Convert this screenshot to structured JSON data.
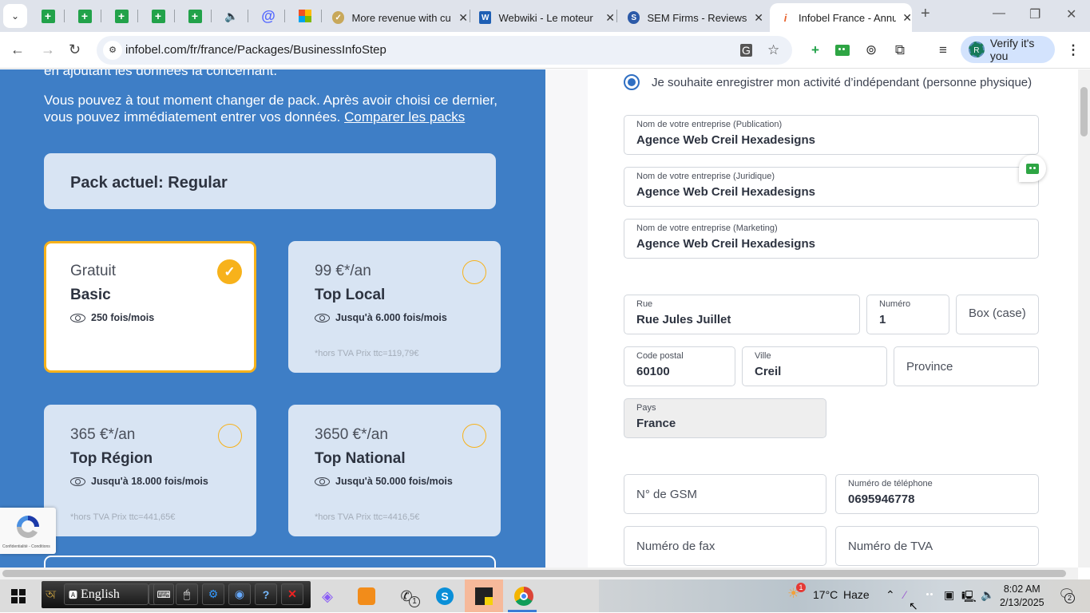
{
  "browser": {
    "pinned_tabs": [
      {
        "icon": "google-sheets-icon"
      },
      {
        "icon": "google-sheets-icon"
      },
      {
        "icon": "google-sheets-icon"
      },
      {
        "icon": "google-sheets-icon"
      },
      {
        "icon": "google-sheets-icon"
      },
      {
        "icon": "speaker-icon"
      },
      {
        "icon": "at-sign-icon"
      },
      {
        "icon": "microsoft-icon"
      }
    ],
    "tabs": [
      {
        "title": "More revenue with cu",
        "icon": "check-badge-icon",
        "active": false
      },
      {
        "title": "Webwiki - Le moteur",
        "icon": "webwiki-icon",
        "active": false
      },
      {
        "title": "SEM Firms - Reviews",
        "icon": "semfirms-icon",
        "active": false
      },
      {
        "title": "Infobel France - Annu",
        "icon": "infobel-icon",
        "active": true
      }
    ],
    "new_tab": "+",
    "window_controls": {
      "minimize": "—",
      "maximize": "❐",
      "close": "✕"
    },
    "url": "infobel.com/fr/france/Packages/BusinessInfoStep",
    "profile_button": "Verify it's you",
    "profile_initial": "R"
  },
  "left_panel": {
    "intro_cut": "en ajoutant les données la concernant.",
    "intro": "Vous pouvez à tout moment changer de pack. Après avoir choisi ce dernier, vous pouvez immédiatement entrer vos données.",
    "compare_link": "Comparer les packs",
    "current_pack": "Pack actuel: Regular",
    "packs": [
      {
        "price": "Gratuit",
        "name": "Basic",
        "views": "250 fois/mois",
        "tva": "",
        "selected": true
      },
      {
        "price": "99 €*/an",
        "name": "Top Local",
        "views": "Jusqu'à 6.000 fois/mois",
        "tva": "*hors TVA Prix ttc=119,79€",
        "selected": false
      },
      {
        "price": "365 €*/an",
        "name": "Top Région",
        "views": "Jusqu'à 18.000 fois/mois",
        "tva": "*hors TVA Prix ttc=441,65€",
        "selected": false
      },
      {
        "price": "3650 €*/an",
        "name": "Top National",
        "views": "Jusqu'à 50.000 fois/mois",
        "tva": "*hors TVA Prix ttc=4416,5€",
        "selected": false
      }
    ],
    "recaptcha_terms": "Confidentialité - Conditions"
  },
  "form": {
    "independent_option": "Je souhaite enregistrer mon activité d’indépendant (personne physique)",
    "company_publication": {
      "label": "Nom de votre entreprise (Publication)",
      "value": "Agence Web Creil Hexadesigns"
    },
    "company_legal": {
      "label": "Nom de votre entreprise (Juridique)",
      "value": "Agence Web Creil Hexadesigns"
    },
    "company_marketing": {
      "label": "Nom de votre entreprise (Marketing)",
      "value": "Agence Web Creil Hexadesigns"
    },
    "street": {
      "label": "Rue",
      "value": "Rue Jules Juillet"
    },
    "number": {
      "label": "Numéro",
      "value": "1"
    },
    "box": {
      "placeholder": "Box (case)"
    },
    "postal_code": {
      "label": "Code postal",
      "value": "60100"
    },
    "city": {
      "label": "Ville",
      "value": "Creil"
    },
    "province": {
      "placeholder": "Province"
    },
    "country": {
      "label": "Pays",
      "value": "France"
    },
    "mobile": {
      "placeholder": "N° de GSM"
    },
    "phone": {
      "label": "Numéro de téléphone",
      "value": "0695946778"
    },
    "fax": {
      "placeholder": "Numéro de fax"
    },
    "vat": {
      "placeholder": "Numéro de TVA"
    }
  },
  "taskbar": {
    "language": "English",
    "weather": {
      "temp": "17°C",
      "condition": "Haze",
      "badge": "1"
    },
    "whatsapp_badge": "1",
    "time": "8:02 AM",
    "date": "2/13/2025",
    "notifications": "2"
  },
  "colors": {
    "panel_blue": "#3e7ec6",
    "card_bg": "#d8e4f3",
    "accent_yellow": "#f7b21b",
    "radio_blue": "#2f6fc3"
  }
}
